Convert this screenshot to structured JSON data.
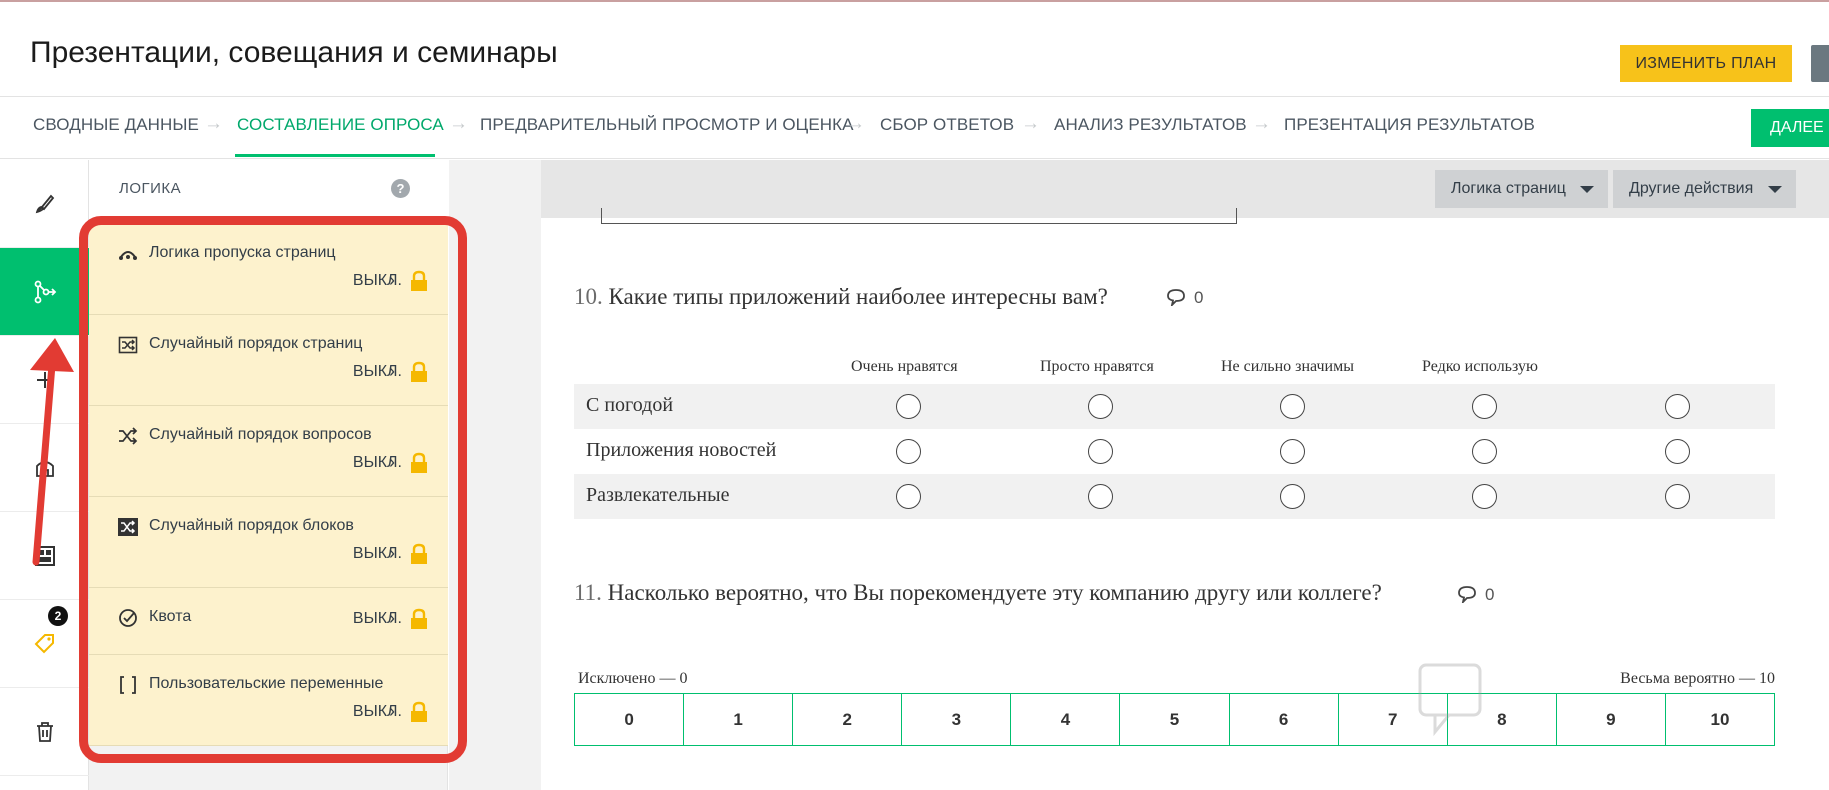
{
  "header": {
    "title": "Презентации, совещания и семинары",
    "change_plan_label": "ИЗМЕНИТЬ ПЛАН"
  },
  "stepnav": {
    "steps": [
      {
        "label": "СВОДНЫЕ ДАННЫЕ",
        "active": false
      },
      {
        "label": "СОСТАВЛЕНИЕ ОПРОСА",
        "active": true
      },
      {
        "label": "ПРЕДВАРИТЕЛЬНЫЙ ПРОСМОТР И ОЦЕНКА",
        "active": false
      },
      {
        "label": "СБОР ОТВЕТОВ",
        "active": false
      },
      {
        "label": "АНАЛИЗ РЕЗУЛЬТАТОВ",
        "active": false
      },
      {
        "label": "ПРЕЗЕНТАЦИЯ РЕЗУЛЬТАТОВ",
        "active": false
      }
    ],
    "next_label": "ДАЛЕЕ"
  },
  "rail": {
    "items": [
      {
        "icon": "paintbrush-icon"
      },
      {
        "icon": "logic-branch-icon",
        "active": true
      },
      {
        "icon": "add-icon"
      },
      {
        "icon": "bag-icon"
      },
      {
        "icon": "layout-icon"
      },
      {
        "icon": "tag-icon",
        "badge": "2"
      },
      {
        "icon": "trash-icon"
      }
    ]
  },
  "panel": {
    "title": "ЛОГИКА",
    "help": "?",
    "items": [
      {
        "label": "Логика пропуска страниц",
        "status": "ВЫКЛ.",
        "icon": "skip-logic-icon"
      },
      {
        "label": "Случайный порядок страниц",
        "status": "ВЫКЛ.",
        "icon": "shuffle-pages-icon"
      },
      {
        "label": "Случайный порядок вопросов",
        "status": "ВЫКЛ.",
        "icon": "shuffle-icon"
      },
      {
        "label": "Случайный порядок блоков",
        "status": "ВЫКЛ.",
        "icon": "shuffle-blocks-icon"
      },
      {
        "label": "Квота",
        "status": "ВЫКЛ.",
        "icon": "quota-check-icon"
      },
      {
        "label": "Пользовательские переменные",
        "status": "ВЫКЛ.",
        "icon": "brackets-icon"
      }
    ]
  },
  "toolbar": {
    "page_logic_label": "Логика страниц",
    "other_actions_label": "Другие действия"
  },
  "q10": {
    "number": "10.",
    "text": "Какие типы приложений наиболее интересны вам?",
    "comments": "0",
    "columns": [
      "Очень нравятся",
      "Просто нравятся",
      "Не сильно значимы",
      "Редко использую"
    ],
    "rows": [
      "С погодой",
      "Приложения новостей",
      "Развлекательные"
    ]
  },
  "q11": {
    "number": "11.",
    "text": "Насколько вероятно, что Вы порекомендуете эту компанию другу или коллеге?",
    "comments": "0",
    "low_label": "Исключено — 0",
    "high_label": "Весьма вероятно — 10",
    "scale": [
      "0",
      "1",
      "2",
      "3",
      "4",
      "5",
      "6",
      "7",
      "8",
      "9",
      "10"
    ]
  },
  "colors": {
    "accent_green": "#00bf6f",
    "plan_button": "#f7c21a",
    "highlight_red": "#e23b33",
    "logic_item_bg": "#fdf2cd",
    "lock_yellow": "#f5b800"
  }
}
